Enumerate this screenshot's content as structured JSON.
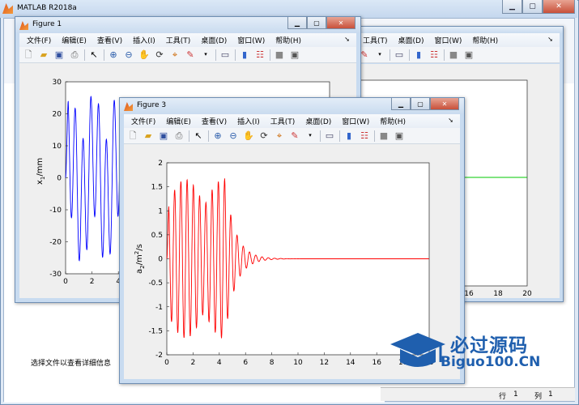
{
  "main_window": {
    "title": "MATLAB R2018a",
    "status": "选择文件以查看详细信息",
    "statusbar": {
      "row_label": "行",
      "row": "1",
      "col_label": "列",
      "col": "1"
    }
  },
  "menu": [
    "文件(F)",
    "编辑(E)",
    "查看(V)",
    "插入(I)",
    "工具(T)",
    "桌面(D)",
    "窗口(W)",
    "帮助(H)"
  ],
  "figure2_tail": {
    "menu_visible": [
      "工具(T)",
      "桌面(D)",
      "窗口(W)",
      "帮助(H)"
    ],
    "xticks": [
      "16",
      "18",
      "20"
    ]
  },
  "figure1": {
    "title": "Figure 1",
    "ylabel": "x",
    "ylabel_sub": "1",
    "ylabel_unit": "/mm",
    "yticks": [
      "30",
      "20",
      "10",
      "0",
      "-10",
      "-20",
      "-30"
    ],
    "xticks": [
      "0",
      "2",
      "4"
    ]
  },
  "figure3": {
    "title": "Figure 3",
    "ylabel": "a",
    "ylabel_sub": "2",
    "ylabel_unit": "/m",
    "ylabel_sup": "2",
    "ylabel_unit2": "/s",
    "yticks": [
      "2",
      "1.5",
      "1",
      "0.5",
      "0",
      "-0.5",
      "-1",
      "-1.5",
      "-2"
    ],
    "xticks": [
      "0",
      "2",
      "4",
      "6",
      "8",
      "10",
      "12",
      "14",
      "16",
      "18",
      "20"
    ]
  },
  "watermark": {
    "line1": "必过源码",
    "line2": "Biguo100.CN"
  },
  "colors": {
    "fig1_line": "#0000ff",
    "fig2_line": "#00c800",
    "fig3_line": "#ff0000",
    "accent": "#1f5fae"
  },
  "icons": [
    "new-file-icon",
    "open-file-icon",
    "save-icon",
    "print-icon",
    "select-arrow-icon",
    "zoom-in-icon",
    "zoom-out-icon",
    "pan-icon",
    "rotate-icon",
    "data-cursor-icon",
    "brush-icon",
    "link-icon",
    "colorbar-icon",
    "legend-icon",
    "hide-tools-icon",
    "dock-icon"
  ]
}
